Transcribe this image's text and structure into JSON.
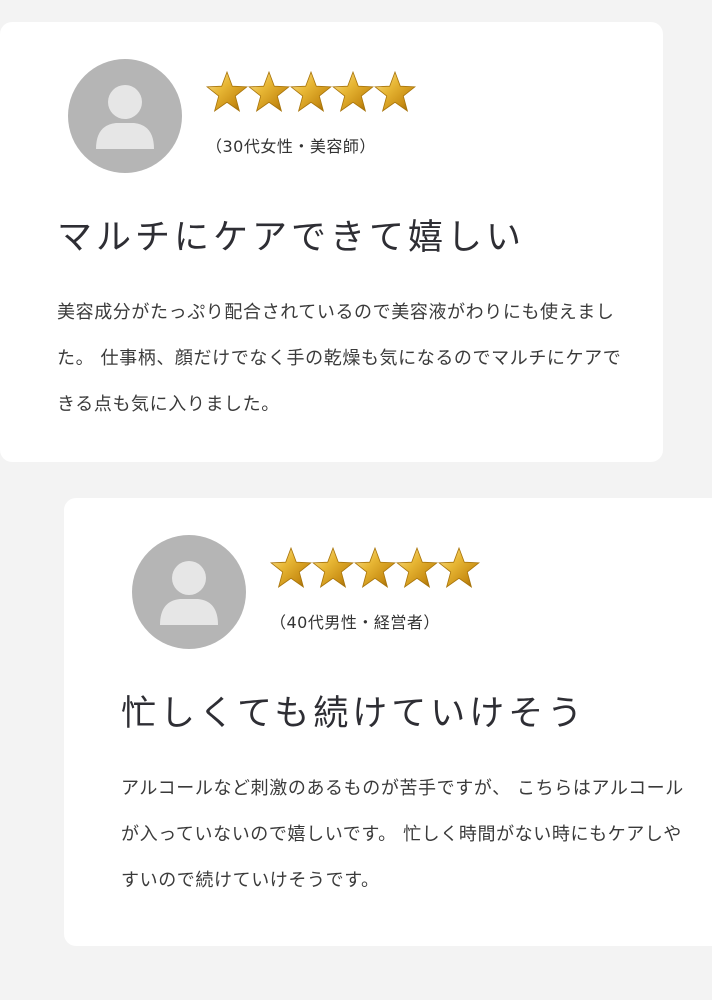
{
  "reviews": [
    {
      "reviewer": "（30代女性・美容師）",
      "rating": 5,
      "headline": "マルチにケアできて嬉しい",
      "body": "美容成分がたっぷり配合されているので美容液がわりにも使えました。 仕事柄、顔だけでなく手の乾燥も気になるのでマルチにケアできる点も気に入りました。"
    },
    {
      "reviewer": "（40代男性・経営者）",
      "rating": 5,
      "headline": "忙しくても続けていけそう",
      "body": "アルコールなど刺激のあるものが苦手ですが、 こちらはアルコールが入っていないので嬉しいです。 忙しく時間がない時にもケアしやすいので続けていけそうです。"
    }
  ],
  "colors": {
    "background": "#f3f3f3",
    "card": "#ffffff",
    "avatar": "#b5b5b5",
    "avatar_figure": "#e6e6e6",
    "star_gold": "#e2b02a"
  },
  "icons": {
    "avatar": "person-silhouette-icon",
    "star": "star-icon"
  }
}
